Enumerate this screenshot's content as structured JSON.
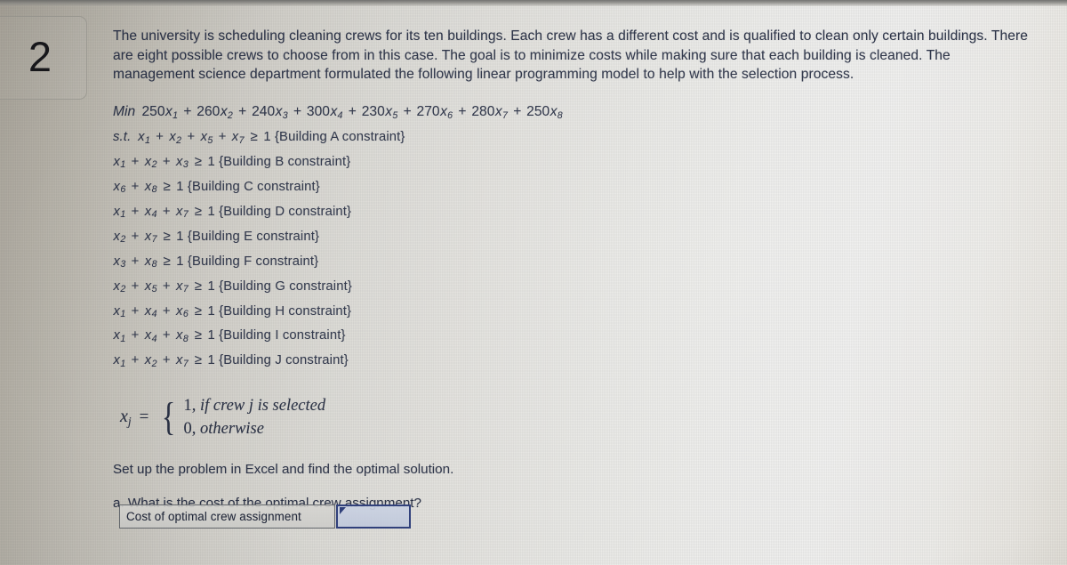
{
  "question_number": "2",
  "prompt": "The university is scheduling cleaning crews for its ten buildings. Each crew has a different cost and is qualified to clean only certain buildings. There are eight possible crews to choose from in this case. The goal is to minimize costs while making sure that each building is cleaned. The management science department formulated the following linear programming model to help with the selection process.",
  "model": {
    "objective": {
      "keyword": "Min",
      "terms": [
        {
          "coef": "250",
          "var": "x",
          "sub": "1"
        },
        {
          "coef": "260",
          "var": "x",
          "sub": "2"
        },
        {
          "coef": "240",
          "var": "x",
          "sub": "3"
        },
        {
          "coef": "300",
          "var": "x",
          "sub": "4"
        },
        {
          "coef": "230",
          "var": "x",
          "sub": "5"
        },
        {
          "coef": "270",
          "var": "x",
          "sub": "6"
        },
        {
          "coef": "280",
          "var": "x",
          "sub": "7"
        },
        {
          "coef": "250",
          "var": "x",
          "sub": "8"
        }
      ],
      "text": "Min 250x1 + 260x2 + 240x3+ 300x4 + 230x5 + 270x6 + 280x7 + 250x8"
    },
    "subject_to_keyword": "s.t.",
    "relation": "≥",
    "rhs": "1",
    "constraints": [
      {
        "vars": [
          "1",
          "2",
          "5",
          "7"
        ],
        "label": "{Building A constraint}",
        "first": true
      },
      {
        "vars": [
          "1",
          "2",
          "3"
        ],
        "label": "{Building B constraint}",
        "first": false
      },
      {
        "vars": [
          "6",
          "8"
        ],
        "label": "{Building C constraint}",
        "first": false
      },
      {
        "vars": [
          "1",
          "4",
          "7"
        ],
        "label": "{Building D constraint}",
        "first": false
      },
      {
        "vars": [
          "2",
          "7"
        ],
        "label": "{Building E constraint}",
        "first": false
      },
      {
        "vars": [
          "3",
          "8"
        ],
        "label": "{Building F constraint}",
        "first": false
      },
      {
        "vars": [
          "2",
          "5",
          "7"
        ],
        "label": "{Building G constraint}",
        "first": false
      },
      {
        "vars": [
          "1",
          "4",
          "6"
        ],
        "label": "{Building H constraint}",
        "first": false
      },
      {
        "vars": [
          "1",
          "4",
          "8"
        ],
        "label": "{Building I constraint}",
        "first": false
      },
      {
        "vars": [
          "1",
          "2",
          "7"
        ],
        "label": "{Building J constraint}",
        "first": false
      }
    ]
  },
  "binary_definition": {
    "variable": "x",
    "subscript": "j",
    "equals": "=",
    "case_one_num": "1,",
    "case_one_text": "if crew j is selected",
    "case_zero_num": "0,",
    "case_zero_text": "otherwise"
  },
  "instructions": {
    "setup": "Set up the problem in Excel and find the optimal solution.",
    "part_a": "a. What is the cost of the optimal crew assignment?"
  },
  "answer": {
    "label": "Cost of optimal crew assignment",
    "value": "",
    "placeholder": ""
  },
  "colors": {
    "text": "#2b3246",
    "input_border": "#2f3f7a",
    "input_fill": "#c9d1e2",
    "label_border": "#63676c"
  }
}
